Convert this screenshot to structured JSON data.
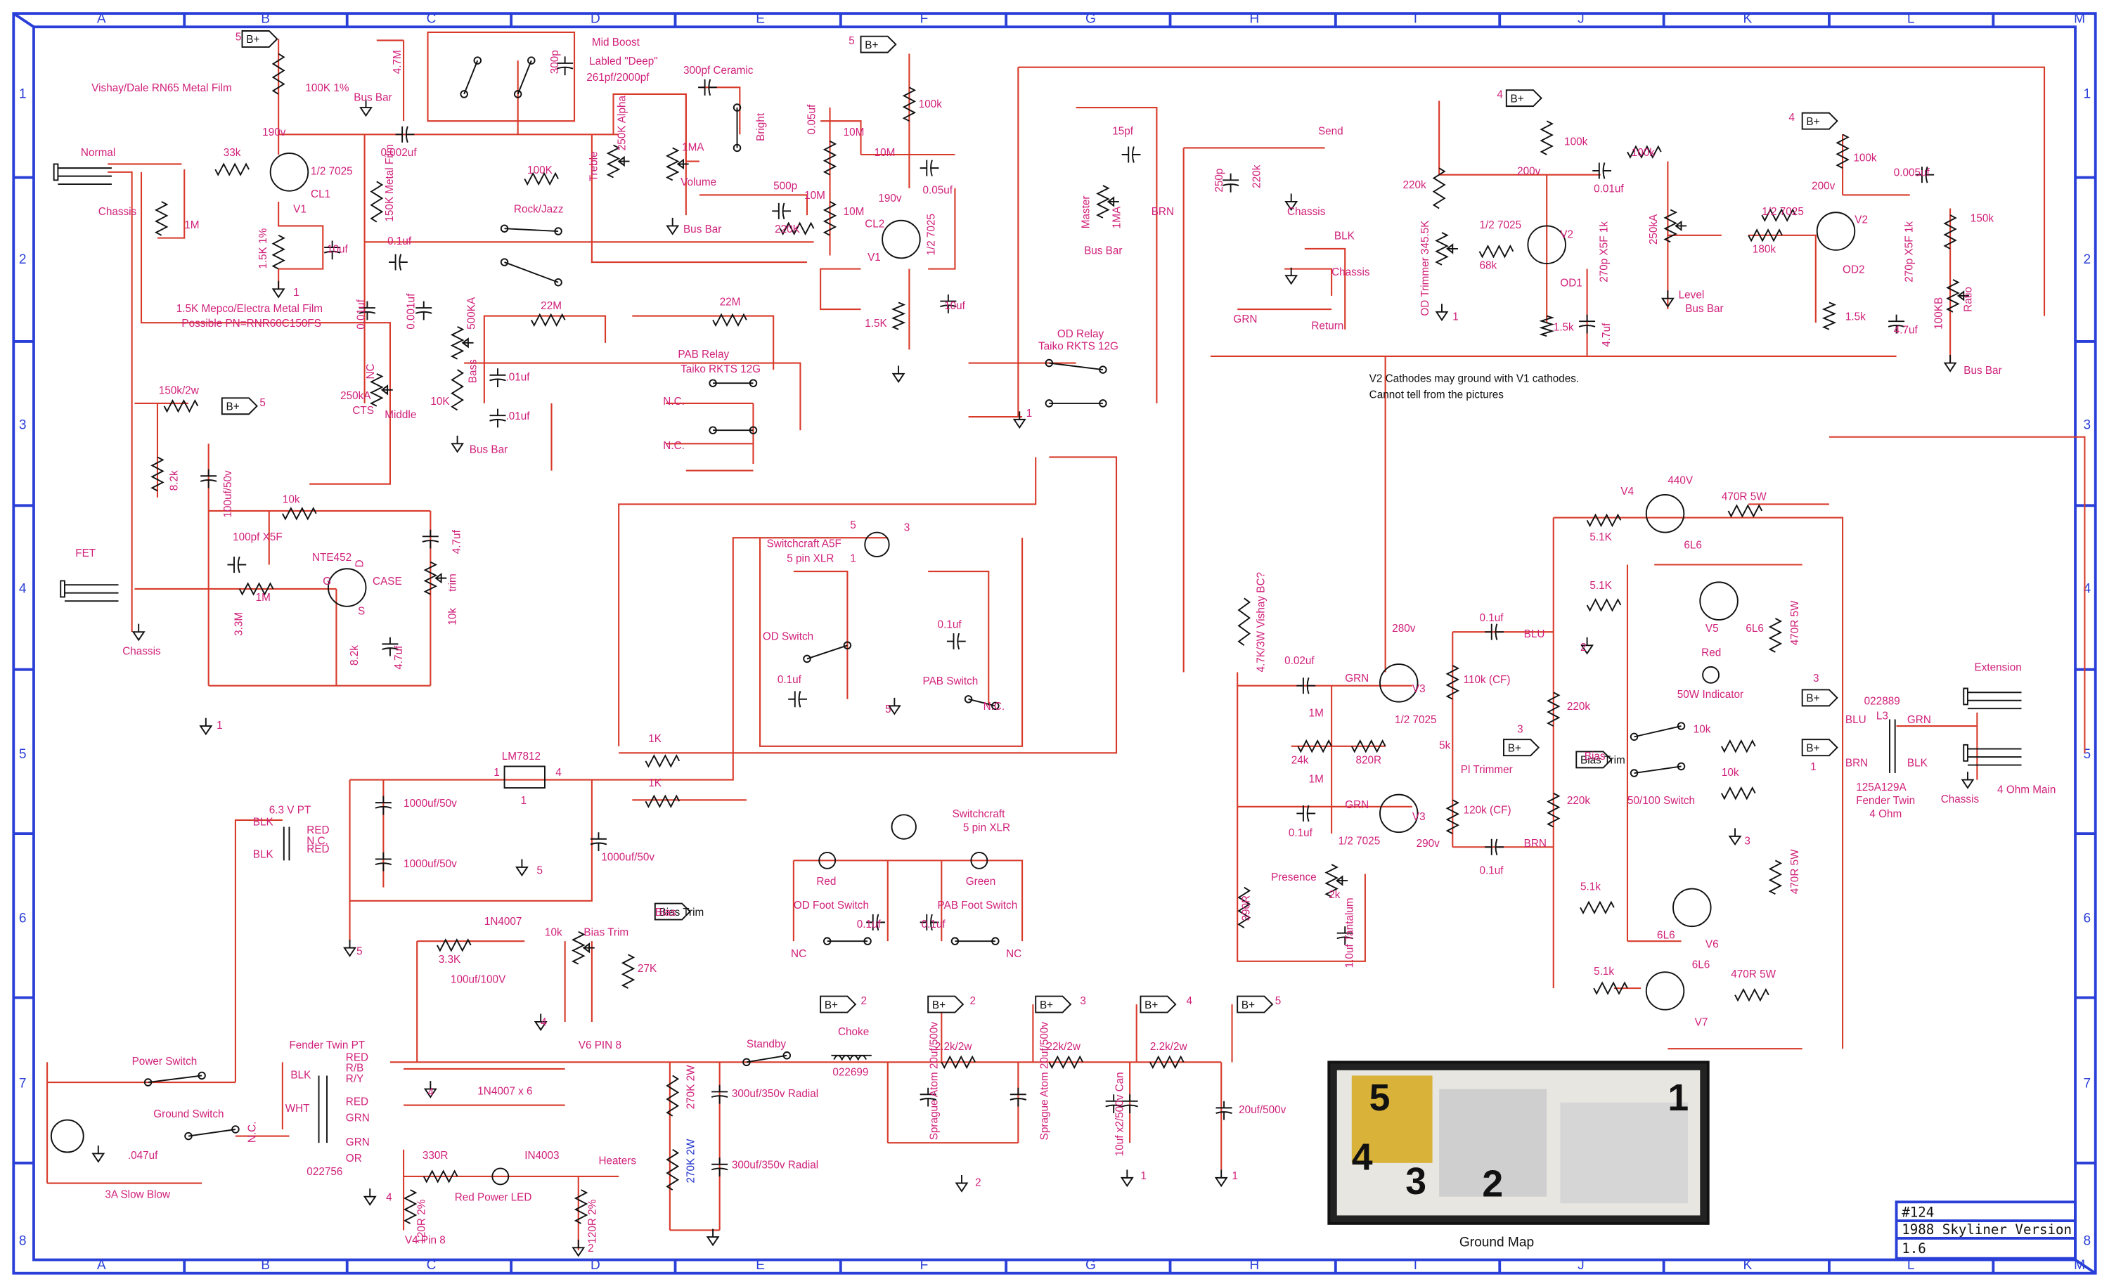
{
  "title_block": {
    "number": "#124",
    "title": "1988 Skyliner Version",
    "version": "1.6"
  },
  "grid": {
    "columns": [
      "A",
      "B",
      "C",
      "D",
      "E",
      "F",
      "G",
      "H",
      "I",
      "J",
      "K",
      "L",
      "M"
    ],
    "rows": [
      "1",
      "2",
      "3",
      "4",
      "5",
      "6",
      "7",
      "8"
    ]
  },
  "colors": {
    "border": "#2a3fd8",
    "wire": "#d83a2a",
    "label": "#d0207a",
    "component": "#111111",
    "pin": "#2233cc"
  },
  "ground_map": {
    "caption": "Ground  Map",
    "markers": [
      "5",
      "4",
      "3",
      "2",
      "1"
    ]
  },
  "supply_tag": "B+",
  "notes": [
    "V2 Cathodes may ground with V1 cathodes.",
    "Cannot tell from the pictures"
  ],
  "labels": [
    "Vishay/Dale RN65 Metal Film",
    "100K 1%",
    "Bus Bar",
    "4.7M",
    "300p",
    "Mid Boost",
    "Labled \"Deep\"",
    "261pf/2000pf",
    "300pf Ceramic",
    "190v",
    "0.002uf",
    "Normal",
    "33k",
    "1/2 7025",
    "CL1",
    "V1",
    "Chassis",
    "1M",
    "150K Metal Film",
    "100K",
    "Treble",
    "250K Alpha",
    "1MA",
    "Volume",
    "Bright",
    "Bus Bar",
    "0.05uf",
    "10M",
    "10M",
    "500p",
    "10M",
    "10M",
    "220K",
    "190v",
    "CL2",
    "V1",
    "1/2 7025",
    "0.05uf",
    "100k",
    "1.5K 1%",
    "10uf",
    "1.5K Mepco/Electra Metal Film",
    "Possible PN=RNR60C150FS",
    "0.1uf",
    "Rock/Jazz",
    "0.01uf",
    "0.001uf",
    "500KA",
    "22M",
    "22M",
    "PAB Relay",
    "Taiko RKTS 12G",
    "1.5K",
    "10uf",
    "250kA",
    "CTS",
    "Middle",
    "10K",
    "Bass",
    ".01uf",
    ".01uf",
    "Bus Bar",
    "N.C.",
    "N.C.",
    "150k/2w",
    "8.2k",
    "100uf/50v",
    "10k",
    "4.7uf",
    "FET",
    "100pf X5F",
    "NTE452",
    "1M",
    "CASE",
    "trim",
    "10k",
    "3.3M",
    "8.2k",
    "4.7uf",
    "Chassis",
    "Master",
    "1MA",
    "15pf",
    "BRN",
    "Bus Bar",
    "250p",
    "220k",
    "Send",
    "Chassis",
    "BLK",
    "Chassis",
    "GRN",
    "Return",
    "OD Relay",
    "Taiko RKTS 12G",
    "100k",
    "200v",
    "0.01uf",
    "100k",
    "220k",
    "1/2 7025",
    "V2",
    "OD1",
    "68k",
    "OD Trimmer 345.5K",
    "270p X5F 1k",
    "1.5k",
    "4.7uf",
    "250kA",
    "Level",
    "Bus Bar",
    "180k",
    "1/2 7025",
    "200v",
    "100k",
    "0.005uf",
    "V2",
    "OD2",
    "270p X5F 1k",
    "1.5k",
    "150k",
    "4.7uf",
    "100KB",
    "Ratio",
    "Bus Bar",
    "440V",
    "V4",
    "470R 5W",
    "5.1K",
    "6L6",
    "5.1K",
    "V5",
    "6L6",
    "470R 5W",
    "Red",
    "50W Indicator",
    "280v",
    "0.1uf",
    "BLU",
    "0.02uf",
    "GRN",
    "110k (CF)",
    "1M",
    "1/2 7025",
    "V3",
    "5k",
    "Pl Trimmer",
    "24k",
    "820R",
    "1M",
    "GRN",
    "V3",
    "120k (CF)",
    "0.1uf",
    "1/2 7025",
    "290v",
    "BRN",
    "0.1uf",
    "220k",
    "220k",
    "Bias",
    "4.7K/3W Vishay BC?",
    "Presence",
    "2k",
    "390R",
    "1.0uf Tantalum",
    "10k",
    "10k",
    "50/100 Switch",
    "Extension",
    "022889",
    "L3",
    "GRN",
    "BLU",
    "BRN",
    "BLK",
    "125A129A",
    "Fender Twin",
    "4 Ohm",
    "Chassis",
    "4 Ohm Main",
    "5.1k",
    "6L6",
    "V6",
    "470R 5W",
    "6L6",
    "5.1k",
    "470R 5W",
    "V7",
    "Switchcraft A5F",
    "5 pin XLR",
    "OD Switch",
    "0.1uf",
    "0.1uf",
    "PAB Switch",
    "N.C.",
    "LM7812",
    "1K",
    "1K",
    "1000uf/50v",
    "1000uf/50v",
    "1000uf/50v",
    "6.3 V PT",
    "BLK",
    "RED",
    "N.C.",
    "RED",
    "BLK",
    "Switchcraft",
    "5 pin XLR",
    "Red",
    "Green",
    "OD Foot Switch",
    "PAB Foot Switch",
    "0.1uf",
    "0.1uf",
    "NC",
    "NC",
    "1N4007",
    "10k",
    "Bias Trim",
    "Bias",
    "3.3K",
    "27K",
    "100uf/100V",
    "V6 PIN 8",
    "Power Switch",
    "Ground Switch",
    "N.C.",
    ".047uf",
    "3A Slow Blow",
    "Fender Twin PT",
    "BLK",
    "RED",
    "R/B",
    "R/Y",
    "WHT",
    "RED",
    "GRN",
    "GRN",
    "OR",
    "022756",
    "1N4007 x 6",
    "330R",
    "IN4003",
    "Heaters",
    "Red Power LED",
    "120R 2%",
    "V4 Pin 8",
    "120R 2%",
    "Standby",
    "Choke",
    "022699",
    "270K 2W",
    "270K 2W",
    "300uf/350v Radial",
    "300uf/350v Radial",
    "2.2k/2w",
    "Sprague Atom 20uf/500v",
    "22k/2w",
    "Sprague Atom 20uf/500v",
    "2.2k/2w",
    "10uf x2/500v Can",
    "20uf/500v",
    "NC",
    "G",
    "D",
    "S"
  ],
  "net_numbers": [
    "5",
    "5",
    "1",
    "5",
    "1",
    "1",
    "4",
    "1",
    "4",
    "2",
    "3",
    "3",
    "1",
    "5",
    "5",
    "3",
    "2",
    "1",
    "5",
    "4",
    "4",
    "4",
    "2",
    "1",
    "2",
    "3",
    "4",
    "5",
    "2",
    "1",
    "1",
    "4",
    "3",
    "5",
    "1"
  ]
}
